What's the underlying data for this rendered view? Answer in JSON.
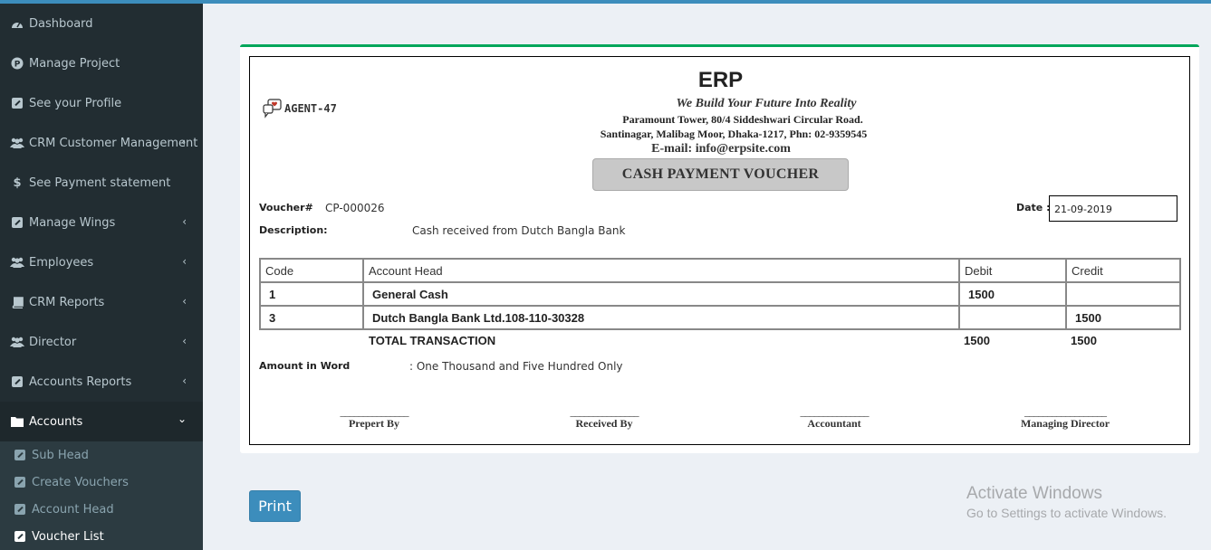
{
  "sidebar": {
    "items": [
      {
        "label": "Dashboard",
        "icon": "dashboard-icon",
        "has_chevron": false
      },
      {
        "label": "Manage Project",
        "icon": "project-icon",
        "has_chevron": false
      },
      {
        "label": "See your Profile",
        "icon": "edit-icon",
        "has_chevron": false
      },
      {
        "label": "CRM Customer Management",
        "icon": "users-icon",
        "has_chevron": true
      },
      {
        "label": "See Payment statement",
        "icon": "dollar-icon",
        "has_chevron": false
      },
      {
        "label": "Manage Wings",
        "icon": "edit-icon",
        "has_chevron": true
      },
      {
        "label": "Employees",
        "icon": "users-icon",
        "has_chevron": true
      },
      {
        "label": "CRM Reports",
        "icon": "book-icon",
        "has_chevron": true
      },
      {
        "label": "Director",
        "icon": "users-icon",
        "has_chevron": true
      },
      {
        "label": "Accounts Reports",
        "icon": "edit-icon",
        "has_chevron": true
      },
      {
        "label": "Accounts",
        "icon": "folder-icon",
        "has_chevron": true
      }
    ],
    "subitems": [
      {
        "label": "Sub Head"
      },
      {
        "label": "Create Vouchers"
      },
      {
        "label": "Account Head"
      },
      {
        "label": "Voucher List"
      }
    ]
  },
  "voucher": {
    "logo_text": "AGENT-47",
    "company": "ERP",
    "tagline": "We Build Your Future Into Reality",
    "address_line1": "Paramount Tower, 80/4 Siddeshwari Circular Road.",
    "address_line2": "Santinagar, Malibag Moor, Dhaka-1217, Phn: 02-9359545",
    "email": "E-mail: info@erpsite.com",
    "title": "CASH PAYMENT VOUCHER",
    "voucher_label": "Voucher#",
    "voucher_no": "CP-000026",
    "date_label": "Date :",
    "date": "21-09-2019",
    "description_label": "Description:",
    "description": "Cash received from Dutch Bangla Bank",
    "table": {
      "headers": [
        "Code",
        "Account Head",
        "Debit",
        "Credit"
      ],
      "rows": [
        [
          "1",
          "General Cash",
          "1500",
          ""
        ],
        [
          "3",
          "Dutch Bangla Bank Ltd.108-110-30328",
          "",
          "1500"
        ]
      ],
      "total_label": "TOTAL TRANSACTION",
      "total_debit": "1500",
      "total_credit": "1500"
    },
    "amount_word_label": "Amount in Word",
    "amount_word": ": One Thousand and Five Hundred Only",
    "signatures": {
      "line_short": "_______________",
      "line_long": "__________________",
      "prepared": "Prepert By",
      "received": "Received By",
      "accountant": "Accountant",
      "director": "Managing Director"
    }
  },
  "actions": {
    "print_label": "Print"
  },
  "watermark": {
    "line1": "Activate Windows",
    "line2": "Go to Settings to activate Windows."
  },
  "colors": {
    "sidebar_bg": "#222d32",
    "accent": "#3c8dbc",
    "box_border_top": "#00a65a"
  }
}
